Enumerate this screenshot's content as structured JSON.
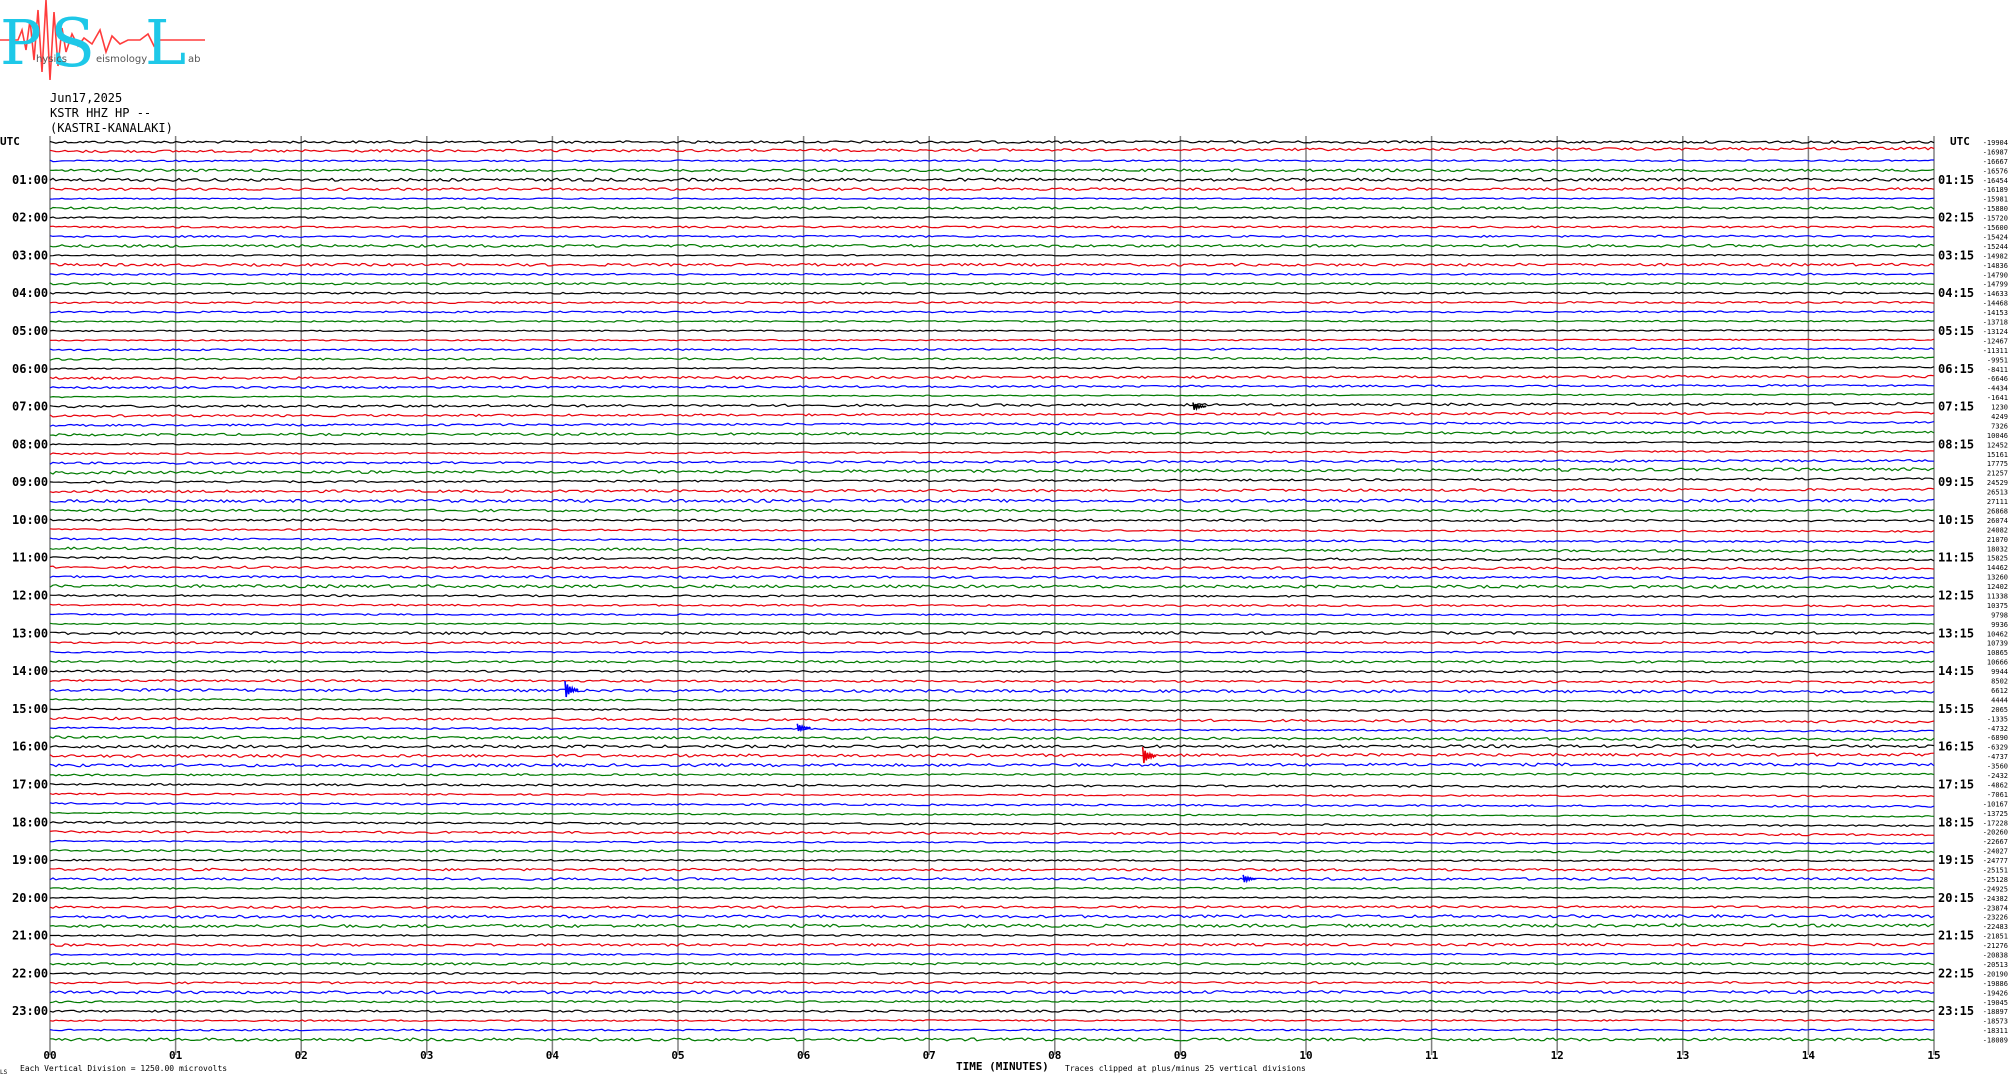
{
  "logo": {
    "letters": "PSL",
    "subtitle_left": "hysics",
    "subtitle_mid": "eismology",
    "subtitle_right": "ab"
  },
  "header": {
    "date": "Jun17,2025",
    "station": "KSTR HHZ HP --",
    "location": "(KASTRI-KANALAKI)"
  },
  "left_axis_title": "UTC",
  "right_axis_title": "UTC",
  "left_time_labels": [
    "01:00",
    "02:00",
    "03:00",
    "04:00",
    "05:00",
    "06:00",
    "07:00",
    "08:00",
    "09:00",
    "10:00",
    "11:00",
    "12:00",
    "13:00",
    "14:00",
    "15:00",
    "16:00",
    "17:00",
    "18:00",
    "19:00",
    "20:00",
    "21:00",
    "22:00",
    "23:00"
  ],
  "right_time_labels": [
    "01:15",
    "02:15",
    "03:15",
    "04:15",
    "05:15",
    "06:15",
    "07:15",
    "08:15",
    "09:15",
    "10:15",
    "11:15",
    "12:15",
    "13:15",
    "14:15",
    "15:15",
    "16:15",
    "17:15",
    "18:15",
    "19:15",
    "20:15",
    "21:15",
    "22:15",
    "23:15"
  ],
  "footer": {
    "scale_note": "Each Vertical Division = 1250.00 microvolts",
    "x_axis_title": "TIME (MINUTES)",
    "clip_note": "Traces clipped at plus/minus 25 vertical divisions",
    "corner_mark": "LS"
  },
  "colors": {
    "trace_cycle": [
      "#000000",
      "#e8000b",
      "#0000ff",
      "#007a00"
    ],
    "grid": "#808080",
    "logo_cyan": "#1ec8e8",
    "logo_red": "#ff3c3c"
  },
  "chart_data": {
    "type": "line",
    "title": "",
    "xlabel": "TIME (MINUTES)",
    "ylabel": "UTC",
    "xlim": [
      0,
      15
    ],
    "x_ticks": [
      "00",
      "01",
      "02",
      "03",
      "04",
      "05",
      "06",
      "07",
      "08",
      "09",
      "10",
      "11",
      "12",
      "13",
      "14",
      "15"
    ],
    "trace_count": 96,
    "trace_interval_minutes": 15,
    "right_offsets": [
      -19904,
      -16987,
      -16667,
      -16576,
      -16454,
      -16189,
      -15981,
      -15880,
      -15720,
      -15600,
      -15424,
      -15244,
      -14982,
      -14836,
      -14790,
      -14799,
      -14633,
      -14468,
      -14153,
      -13718,
      -13124,
      -12467,
      -11311,
      -9951,
      -8411,
      -6646,
      -4434,
      -1641,
      1230,
      4249,
      7326,
      10046,
      12452,
      15161,
      17775,
      21257,
      24529,
      26513,
      27111,
      26868,
      26074,
      24082,
      21070,
      18032,
      15825,
      14462,
      13260,
      12402,
      11338,
      10375,
      9798,
      9936,
      10462,
      10739,
      10865,
      10666,
      9944,
      8502,
      6612,
      4444,
      2065,
      -1335,
      -4732,
      -6890,
      -6329,
      -4737,
      -3560,
      -2432,
      -4862,
      -7061,
      -10167,
      -13725,
      -17228,
      -20260,
      -22667,
      -24027,
      -24777,
      -25151,
      -25128,
      -24925,
      -24382,
      -23874,
      -23226,
      -22483,
      -21851,
      -21276,
      -20838,
      -20513,
      -20190,
      -19886,
      -19426,
      -19045,
      -18897,
      -18573,
      -18311,
      -18089
    ],
    "events": [
      {
        "trace": 28,
        "minute": 9.1,
        "amplitude": "small"
      },
      {
        "trace": 58,
        "minute": 4.1,
        "amplitude": "medium"
      },
      {
        "trace": 62,
        "minute": 5.95,
        "amplitude": "small"
      },
      {
        "trace": 65,
        "minute": 8.7,
        "amplitude": "medium"
      },
      {
        "trace": 78,
        "minute": 9.5,
        "amplitude": "small"
      }
    ]
  }
}
